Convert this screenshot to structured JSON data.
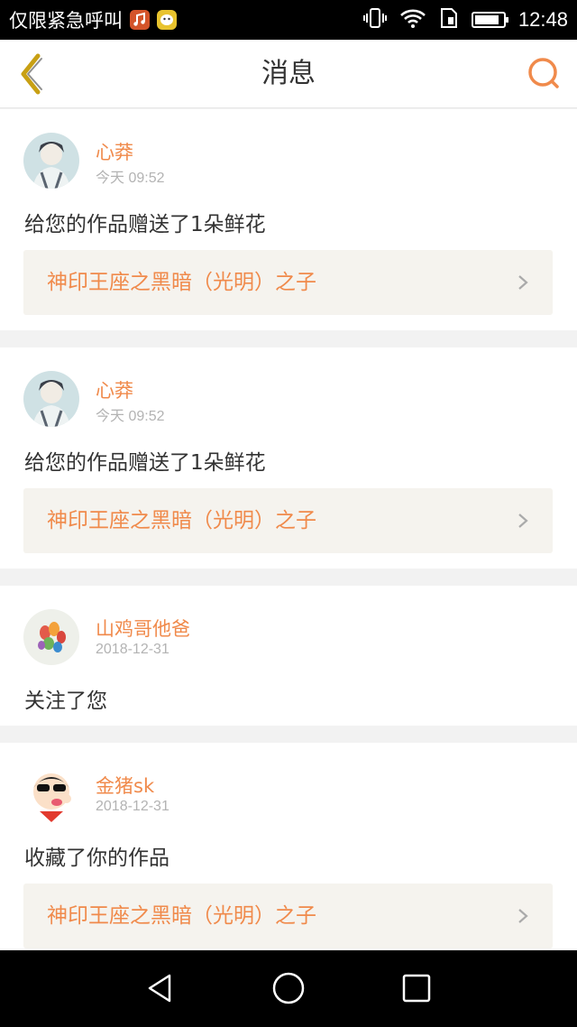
{
  "status_bar": {
    "carrier": "仅限紧急呼叫",
    "time": "12:48",
    "battery_level": 0.85,
    "icons": [
      "music-app-icon",
      "chat-app-icon",
      "vibrate-icon",
      "wifi-icon",
      "sim-icon",
      "battery-icon"
    ]
  },
  "nav": {
    "title": "消息",
    "back_icon": "chevron-left-icon",
    "search_icon": "search-icon"
  },
  "messages": [
    {
      "user": "心莽",
      "time": "今天 09:52",
      "action": "给您的作品赠送了1朵鲜花",
      "work": "神印王座之黑暗（光明）之子"
    },
    {
      "user": "心莽",
      "time": "今天 09:52",
      "action": "给您的作品赠送了1朵鲜花",
      "work": "神印王座之黑暗（光明）之子"
    },
    {
      "user": "山鸡哥他爸",
      "time": "2018-12-31",
      "action": "关注了您"
    },
    {
      "user": "金猪sk",
      "time": "2018-12-31",
      "action": "收藏了你的作品",
      "work": "神印王座之黑暗（光明）之子"
    }
  ],
  "colors": {
    "accent": "#f08a4b",
    "back_icon": "#c8a014",
    "card_bg": "#f5f3ee"
  },
  "system_nav": [
    "back-triangle-icon",
    "home-circle-icon",
    "recents-square-icon"
  ]
}
